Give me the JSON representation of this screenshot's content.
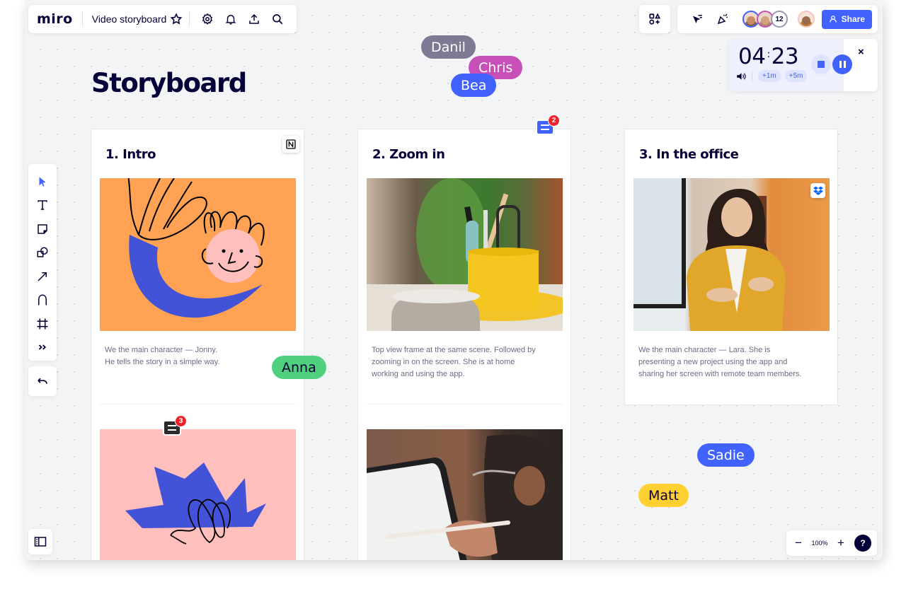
{
  "app": {
    "logo": "miro",
    "board_title": "Video storyboard"
  },
  "top_toolbar": {
    "icons": [
      "star-icon",
      "settings-icon",
      "bell-icon",
      "upload-icon",
      "search-icon"
    ]
  },
  "collaboration": {
    "extra_collaborators_count": "12",
    "share_label": "Share",
    "avatar_colors": [
      "#4262ff",
      "#c650b8",
      "#9a98ad",
      "#f5a8a0"
    ]
  },
  "timer": {
    "minutes": "04",
    "seconds": "23",
    "add_one_label": "+1m",
    "add_five_label": "+5m",
    "close_label": "×"
  },
  "board": {
    "heading": "Storyboard",
    "cards": [
      {
        "title": "1. Intro",
        "integration_badge": "notion-icon",
        "description_lines": [
          "We the main character — Jonny.",
          "He tells the story in a simple way."
        ]
      },
      {
        "title": "2. Zoom in",
        "description_lines": [
          "Top view frame at the same scene. Followed by",
          "zooming in on the screen. She is at home",
          "working and using the app."
        ]
      },
      {
        "title": "3. In the office",
        "integration_badge": "dropbox-icon",
        "description_lines": [
          "We the main character — Lara. She is",
          "presenting a new project using the app and",
          "sharing her screen with remote team members."
        ]
      }
    ],
    "comments": [
      {
        "count": "2",
        "color": "#4262ff"
      },
      {
        "count": "3",
        "color": "#2b2b2b"
      }
    ]
  },
  "cursors": [
    {
      "name": "Danil",
      "color": "#7d7a94",
      "text_color": "#ffffff"
    },
    {
      "name": "Chris",
      "color": "#c650b8",
      "text_color": "#ffffff"
    },
    {
      "name": "Bea",
      "color": "#4262ff",
      "text_color": "#ffffff"
    },
    {
      "name": "Anna",
      "color": "#4ed07c",
      "text_color": "#050038"
    },
    {
      "name": "Sadie",
      "color": "#4262ff",
      "text_color": "#ffffff"
    },
    {
      "name": "Matt",
      "color": "#ffd02f",
      "text_color": "#050038"
    }
  ],
  "tools": [
    "select",
    "text",
    "sticky-note",
    "shapes",
    "connection-line",
    "pen",
    "frame",
    "more"
  ],
  "zoom": {
    "minus": "−",
    "level": "100%",
    "plus": "+",
    "help": "?"
  },
  "colors": {
    "accent": "#4262ff",
    "ink": "#050038",
    "canvas": "#f3f4f5"
  }
}
